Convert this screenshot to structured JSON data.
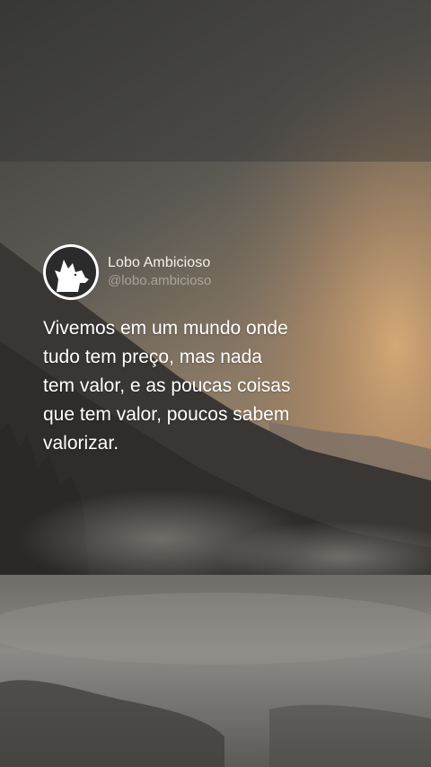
{
  "post": {
    "author_name": "Lobo Ambicioso",
    "author_handle": "@lobo.ambicioso",
    "avatar_icon": "wolf-icon",
    "quote": "Vivemos em um mundo onde\ntudo tem preço, mas nada\ntem valor, e as poucas coisas\nque tem valor, poucos sabem\nvalorizar."
  },
  "colors": {
    "text": "#ffffff",
    "handle": "#b9b4aa",
    "sky_glow": "#c49a6a"
  }
}
